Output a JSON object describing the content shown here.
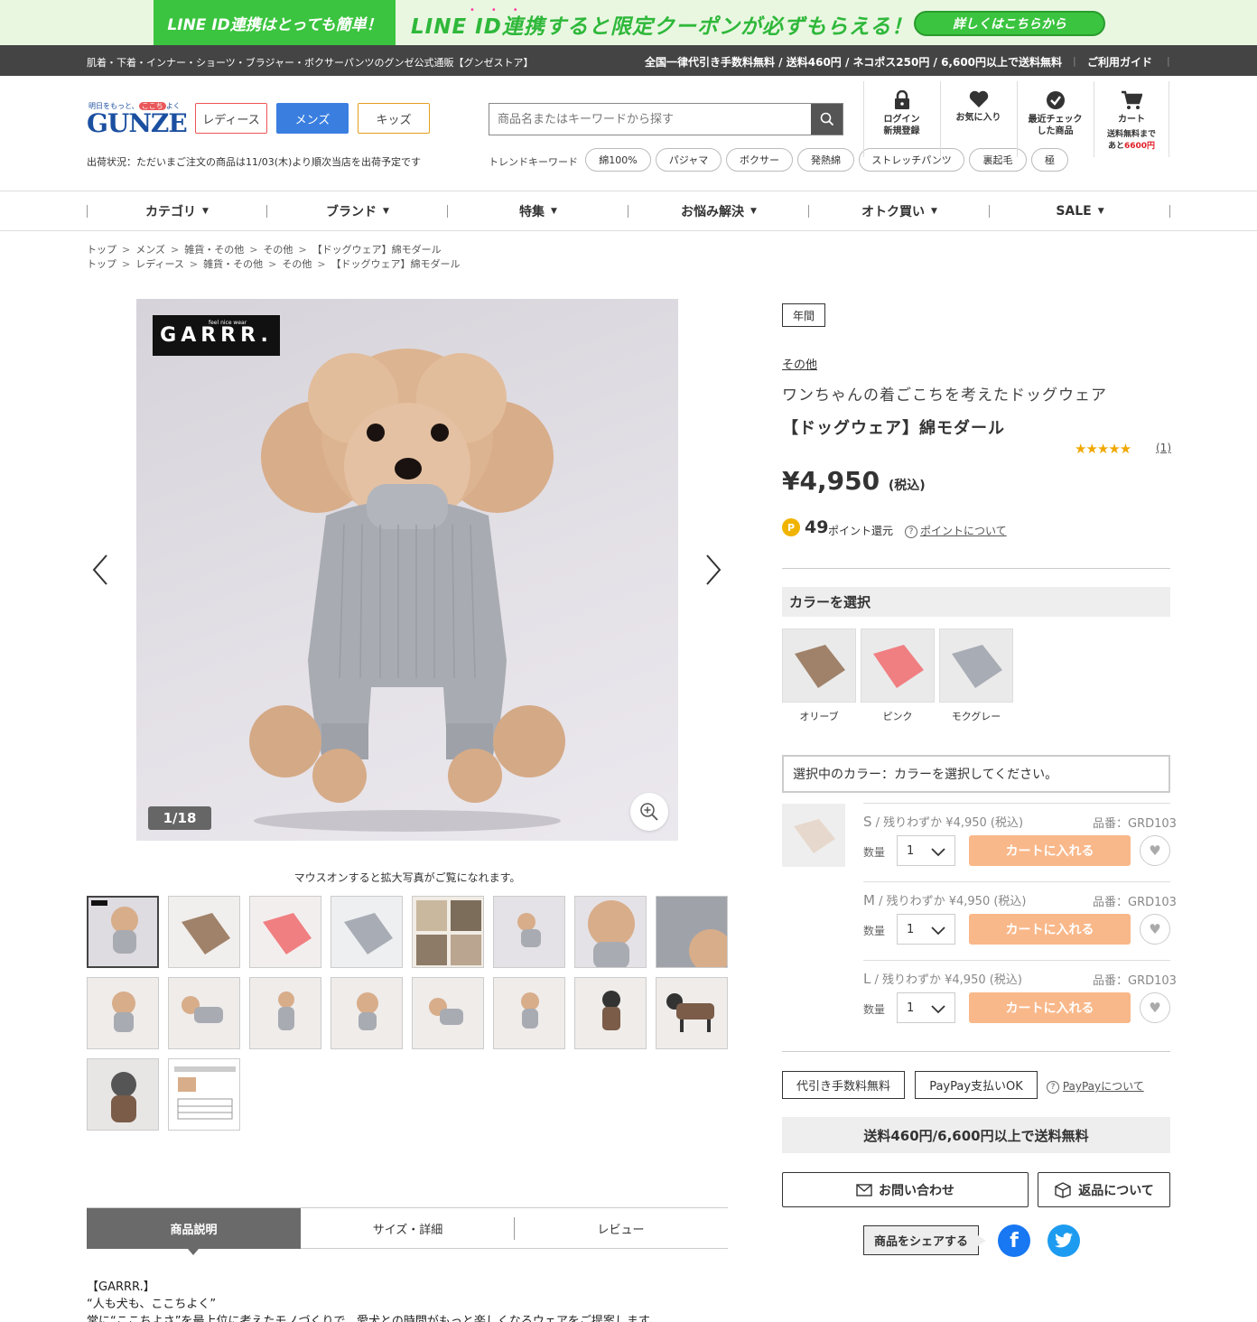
{
  "banner": {
    "left": "LINE ID連携はとっても簡単！",
    "headline": "LINE ID連携すると限定クーポンが必ずもらえる！",
    "button": "詳しくはこちらから"
  },
  "infobar": {
    "site": "肌着・下着・インナー・ショーツ・ブラジャー・ボクサーパンツのグンゼ公式通販【グンゼストア】",
    "shipping": "全国一律代引き手数料無料 / 送料460円 / ネコポス250円 / 6,600円以上で送料無料",
    "guide": "ご利用ガイド"
  },
  "header": {
    "logo_tagline_a": "明日をもっと、",
    "logo_tagline_b": "ここち",
    "logo_tagline_c": "よく",
    "logo": "GUNZE",
    "gender": [
      "レディース",
      "メンズ",
      "キッズ"
    ],
    "ship_status": "出荷状況：ただいまご注文の商品は11/03(木)より順次当店を出荷予定です",
    "search_placeholder": "商品名またはキーワードから探す",
    "trend_label": "トレンドキーワード",
    "keywords": [
      "綿100%",
      "パジャマ",
      "ボクサー",
      "発熱綿",
      "ストレッチパンツ",
      "裏起毛",
      "極"
    ],
    "login_a": "ログイン",
    "login_b": "新規登録",
    "favorites": "お気に入り",
    "recent_a": "最近チェック",
    "recent_b": "した商品",
    "cart": "カート",
    "cart_note_a": "送料無料まで",
    "cart_note_b": "あと",
    "cart_note_amount": "6600円"
  },
  "nav": [
    "カテゴリ",
    "ブランド",
    "特集",
    "お悩み解決",
    "オトク買い",
    "SALE"
  ],
  "breadcrumbs": [
    [
      "トップ",
      "メンズ",
      "雑貨・その他",
      "その他",
      "【ドッグウェア】綿モダール"
    ],
    [
      "トップ",
      "レディース",
      "雑貨・その他",
      "その他",
      "【ドッグウェア】綿モダール"
    ]
  ],
  "gallery": {
    "brand_small": "feel nice wear",
    "brand": "GARRR.",
    "counter": "1/18",
    "hint": "マウスオンすると拡大写真がご覧になれます。"
  },
  "tabs": [
    "商品説明",
    "サイズ・詳細",
    "レビュー"
  ],
  "description": [
    "【GARRR.】",
    "“人も犬も、ここちよく”",
    "常に“ここちよさ”を最上位に考えたモノづくりで、愛犬との時間がもっと楽しくなるウェアをご提案します。"
  ],
  "product": {
    "badge": "年間",
    "category": "その他",
    "catch": "ワンちゃんの着ごこちを考えたドッグウェア",
    "name": "【ドッグウェア】綿モダール",
    "stars": "★★★★★",
    "rating": 5,
    "review_count": "(1)",
    "price": "¥4,950",
    "tax": "(税込)",
    "points": "49",
    "points_label": "ポイント還元",
    "points_info": "ポイントについて",
    "color_heading": "カラーを選択",
    "colors": [
      {
        "name": "オリーブ",
        "hex": "#a0826a"
      },
      {
        "name": "ピンク",
        "hex": "#f07f82"
      },
      {
        "name": "モクグレー",
        "hex": "#a8acb4"
      }
    ],
    "selected_color": "選択中のカラー：カラーを選択してください。",
    "sizes": [
      {
        "size": "S",
        "stock": " / 残りわずか ¥4,950 (税込)",
        "code": "品番：GRD103",
        "qty_label": "数量",
        "qty": "1",
        "cart": "カートに入れる"
      },
      {
        "size": "M",
        "stock": " / 残りわずか ¥4,950 (税込)",
        "code": "品番：GRD103",
        "qty_label": "数量",
        "qty": "1",
        "cart": "カートに入れる"
      },
      {
        "size": "L",
        "stock": " / 残りわずか ¥4,950 (税込)",
        "code": "品番：GRD103",
        "qty_label": "数量",
        "qty": "1",
        "cart": "カートに入れる"
      }
    ],
    "chip_cod": "代引き手数料無料",
    "chip_paypay": "PayPay支払いOK",
    "paypay_info": "PayPayについて",
    "shipping": "送料460円/6,600円以上で送料無料",
    "contact": "お問い合わせ",
    "returns": "返品について",
    "share": "商品をシェアする"
  }
}
